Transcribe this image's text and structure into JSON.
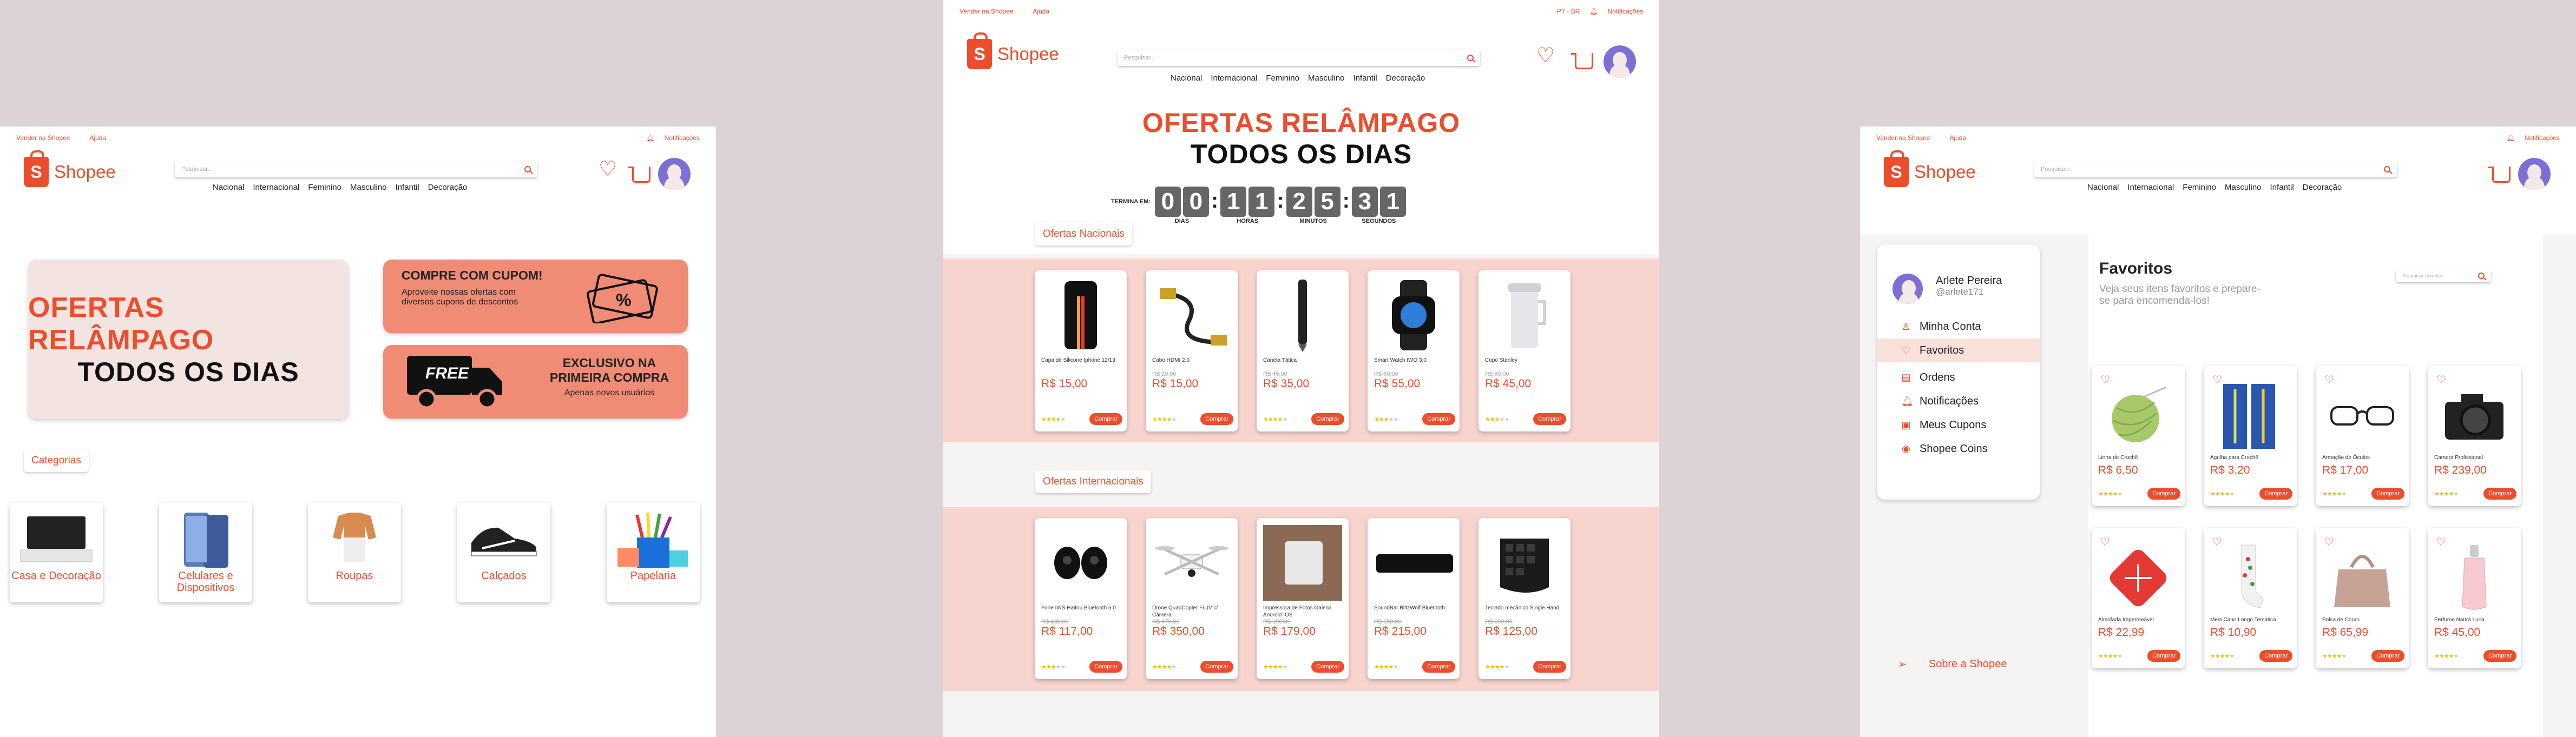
{
  "common": {
    "brand": "Shopee",
    "sell_link": "Vender na Shopee",
    "help_link": "Ajuda",
    "notifications": "Notificações",
    "lang": "PT - BR",
    "search_placeholder": "Pesquisar...",
    "nav": [
      "Nacional",
      "Internacional",
      "Feminino",
      "Masculino",
      "Infantil",
      "Decoração"
    ]
  },
  "home": {
    "hero_line1": "OFERTAS RELÂMPAGO",
    "hero_line2": "TODOS OS DIAS",
    "coupon_title": "COMPRE COM CUPOM!",
    "coupon_sub": "Aproveite nossas ofertas com diversos cupons de descontos",
    "free_badge": "FREE",
    "free_title": "EXCLUSIVO NA PRIMEIRA COMPRA",
    "free_sub": "Apenas novos usuários",
    "categories_label": "Categorias",
    "categories": [
      {
        "label": "Casa e Decoração",
        "icon": "tv-stand-icon"
      },
      {
        "label": "Celulares e Dispositivos",
        "icon": "smartphones-icon"
      },
      {
        "label": "Roupas",
        "icon": "clothes-icon"
      },
      {
        "label": "Calçados",
        "icon": "sneakers-icon"
      },
      {
        "label": "Papelaria",
        "icon": "stationery-icon"
      }
    ]
  },
  "flash": {
    "title1": "OFERTAS RELÂMPAGO",
    "title2": "TODOS OS DIAS",
    "ends_label": "TERMINA EM:",
    "days": [
      "0",
      "0"
    ],
    "hours": [
      "1",
      "1"
    ],
    "minutes": [
      "2",
      "5"
    ],
    "seconds": [
      "3",
      "1"
    ],
    "unit_days": "DIAS",
    "unit_hours": "HORAS",
    "unit_minutes": "MINUTOS",
    "unit_seconds": "SEGUNDOS",
    "buy_label": "Comprar",
    "national_label": "Ofertas Nacionais",
    "international_label": "Ofertas Internacionais",
    "national": [
      {
        "name": "Capa de Silicone Iphone 12/13",
        "old": "",
        "price": "R$ 15,00",
        "stars": 4,
        "icon": "phone-case-icon"
      },
      {
        "name": "Cabo HDMI 2.0",
        "old": "R$ 20,00",
        "price": "R$ 15,00",
        "stars": 4,
        "icon": "hdmi-cable-icon"
      },
      {
        "name": "Caneta Tática",
        "old": "R$ 45,00",
        "price": "R$ 35,00",
        "stars": 4,
        "icon": "pen-icon"
      },
      {
        "name": "Smart Watch IWO 3.0",
        "old": "R$ 60,00",
        "price": "R$ 55,00",
        "stars": 3,
        "icon": "smartwatch-icon"
      },
      {
        "name": "Copo Stanley",
        "old": "R$ 60,00",
        "price": "R$ 45,00",
        "stars": 3,
        "icon": "cup-icon"
      }
    ],
    "international": [
      {
        "name": "Fone IWS Haitou Bluetooth 5.0",
        "old": "R$ 130,00",
        "price": "R$ 117,00",
        "stars": 3,
        "icon": "earbuds-icon"
      },
      {
        "name": "Drone QuadCopter FLJV c/ Câmera",
        "old": "R$ 470,00",
        "price": "R$ 350,00",
        "stars": 4,
        "icon": "drone-icon"
      },
      {
        "name": "Impressora de Fotos Galeria Android IOS",
        "old": "R$ 190,00",
        "price": "R$ 179,00",
        "stars": 4,
        "icon": "printer-icon"
      },
      {
        "name": "SoundBar BiltzWolf Bluetooth",
        "old": "R$ 250,00",
        "price": "R$ 215,00",
        "stars": 4,
        "icon": "soundbar-icon"
      },
      {
        "name": "Teclado mecânico Single Hand",
        "old": "R$ 150,00",
        "price": "R$ 125,00",
        "stars": 4,
        "icon": "keyboard-icon"
      }
    ]
  },
  "favorites": {
    "user_name": "Arlete Pereira",
    "user_handle": "@arlete171",
    "menu": [
      {
        "label": "Minha Conta",
        "icon": "user-icon"
      },
      {
        "label": "Favoritos",
        "icon": "heart-icon"
      },
      {
        "label": "Ordens",
        "icon": "clipboard-icon"
      },
      {
        "label": "Notificações",
        "icon": "bell-icon"
      },
      {
        "label": "Meus Cupons",
        "icon": "ticket-icon"
      },
      {
        "label": "Shopee Coins",
        "icon": "coin-icon"
      }
    ],
    "about": "Sobre a Shopee",
    "title": "Favoritos",
    "subtitle": "Veja seus itens favoritos e prepare-se para encomenda-los!",
    "search_placeholder": "Pesquisar favoritos",
    "buy_label": "Comprar",
    "items": [
      {
        "name": "Linha de Crochê",
        "price": "R$ 6,50",
        "icon": "yarn-icon"
      },
      {
        "name": "Agulha para Crochê",
        "price": "R$ 3,20",
        "icon": "needles-icon"
      },
      {
        "name": "Armação de Óculos",
        "price": "R$ 17,00",
        "icon": "glasses-icon"
      },
      {
        "name": "Camera Profissional",
        "price": "R$ 239,00",
        "icon": "camera-icon"
      },
      {
        "name": "Almofada Impermeável",
        "price": "R$ 22,99",
        "icon": "pillow-icon"
      },
      {
        "name": "Meia Cano Longo Temática",
        "price": "R$ 10,90",
        "icon": "socks-icon"
      },
      {
        "name": "Bolsa de Couro",
        "price": "R$ 65,99",
        "icon": "handbag-icon"
      },
      {
        "name": "Perfume Naura Luna",
        "price": "R$ 45,00",
        "icon": "perfume-icon"
      }
    ]
  }
}
